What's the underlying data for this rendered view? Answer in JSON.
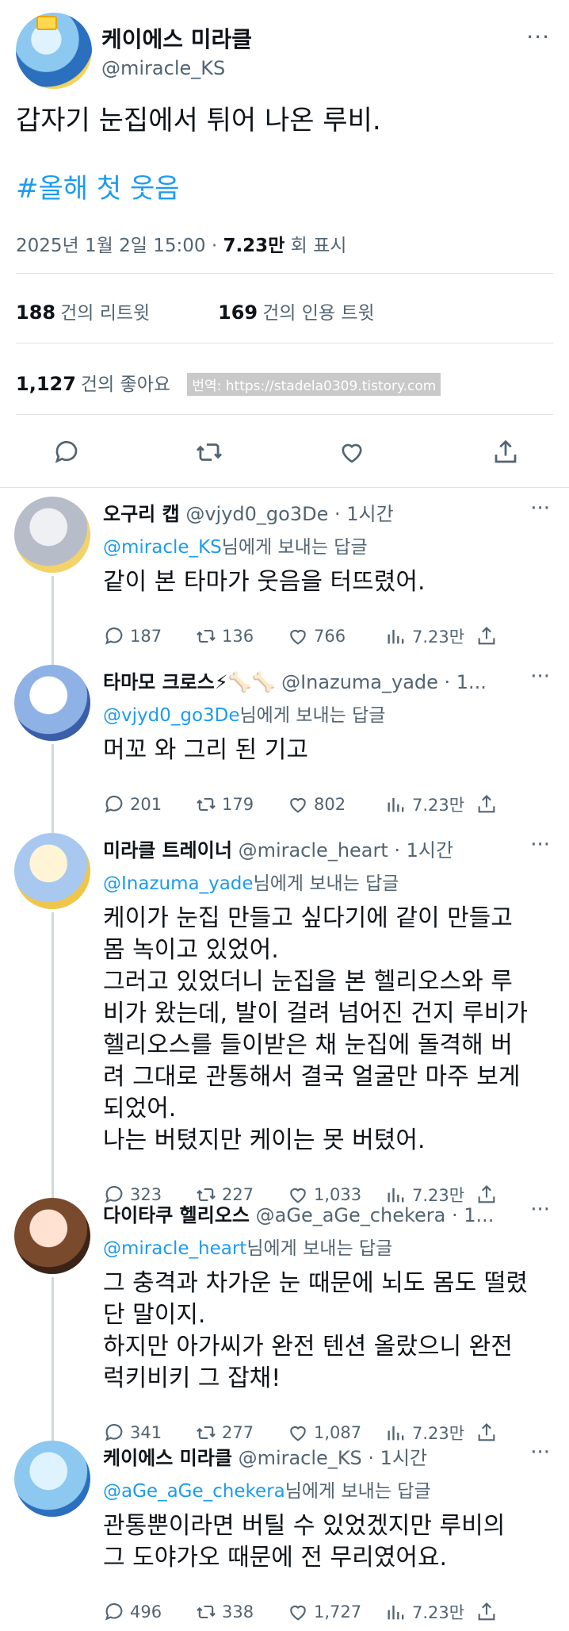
{
  "tweet": {
    "author_name": "케이에스 미라클",
    "author_handle": "@miracle_KS",
    "more": "···",
    "text": "갑자기 눈집에서 튀어 나온 루비.",
    "hashtag": "#올해 첫 웃음",
    "datetime": "2025년 1월 2일 15:00",
    "dot": "·",
    "views": "7.23만",
    "views_label": "회 표시",
    "retweets": "188",
    "retweets_label": "건의 리트윗",
    "quotes": "169",
    "quotes_label": "건의 인용 트윗",
    "likes": "1,127",
    "likes_label": "건의 좋아요",
    "watermark": "번역: https://stadela0309.tistory.com"
  },
  "replies": [
    {
      "name": "오구리 캡",
      "handle": "@vjyd0_go3De · 1시간",
      "reply_to": "@miracle_KS",
      "reply_suffix": "님에게 보내는 답글",
      "body": "같이 본 타마가 웃음을 터뜨렸어.",
      "replies": "187",
      "retweets": "136",
      "likes": "766",
      "views": "7.23만",
      "avatar_colors": [
        "#eef0f4",
        "#b7bcc9",
        "#f2d36a"
      ]
    },
    {
      "name": "타마모 크로스⚡🦴🦴",
      "handle": "@Inazuma_yade · 1...",
      "reply_to": "@vjyd0_go3De",
      "reply_suffix": "님에게 보내는 답글",
      "body": "머꼬 와 그리 된 기고",
      "replies": "201",
      "retweets": "179",
      "likes": "802",
      "views": "7.23만",
      "avatar_colors": [
        "#ffffff",
        "#8fb2e6",
        "#3b5ea8"
      ]
    },
    {
      "name": "미라클 트레이너",
      "handle": "@miracle_heart · 1시간",
      "reply_to": "@Inazuma_yade",
      "reply_suffix": "님에게 보내는 답글",
      "body": "케이가 눈집 만들고 싶다기에 같이 만들고\n몸 녹이고 있었어.\n그러고 있었더니 눈집을 본 헬리오스와 루\n비가 왔는데, 발이 걸려 넘어진 건지 루비가\n헬리오스를 들이받은 채 눈집에 돌격해 버\n려 그대로 관통해서 결국 얼굴만 마주 보게\n되었어.\n나는 버텼지만 케이는 못 버텼어.",
      "replies": "323",
      "retweets": "227",
      "likes": "1,033",
      "views": "7.23만",
      "avatar_colors": [
        "#fff4d6",
        "#a8c8f0",
        "#f0c64a"
      ]
    },
    {
      "name": "다이타쿠 헬리오스",
      "handle": "@aGe_aGe_chekera · 1...",
      "reply_to": "@miracle_heart",
      "reply_suffix": "님에게 보내는 답글",
      "body": "그 충격과 차가운 눈 때문에 뇌도 몸도 떨렸\n단 말이지.\n하지만 아가씨가 완전 텐션 올랐으니 완전\n럭키비키 그 잡채!",
      "replies": "341",
      "retweets": "277",
      "likes": "1,087",
      "views": "7.23만",
      "avatar_colors": [
        "#ffe2d1",
        "#7a4a2c",
        "#3a2418"
      ]
    },
    {
      "name": "케이에스 미라클",
      "handle": "@miracle_KS · 1시간",
      "reply_to": "@aGe_aGe_chekera",
      "reply_suffix": "님에게 보내는 답글",
      "body": "관통뿐이라면 버틸 수 있었겠지만 루비의\n그 도야가오 때문에 전 무리였어요.",
      "replies": "496",
      "retweets": "338",
      "likes": "1,727",
      "views": "7.23만",
      "avatar_colors": [
        "#dff3ff",
        "#8cc8ef",
        "#2b6fbf"
      ]
    }
  ]
}
